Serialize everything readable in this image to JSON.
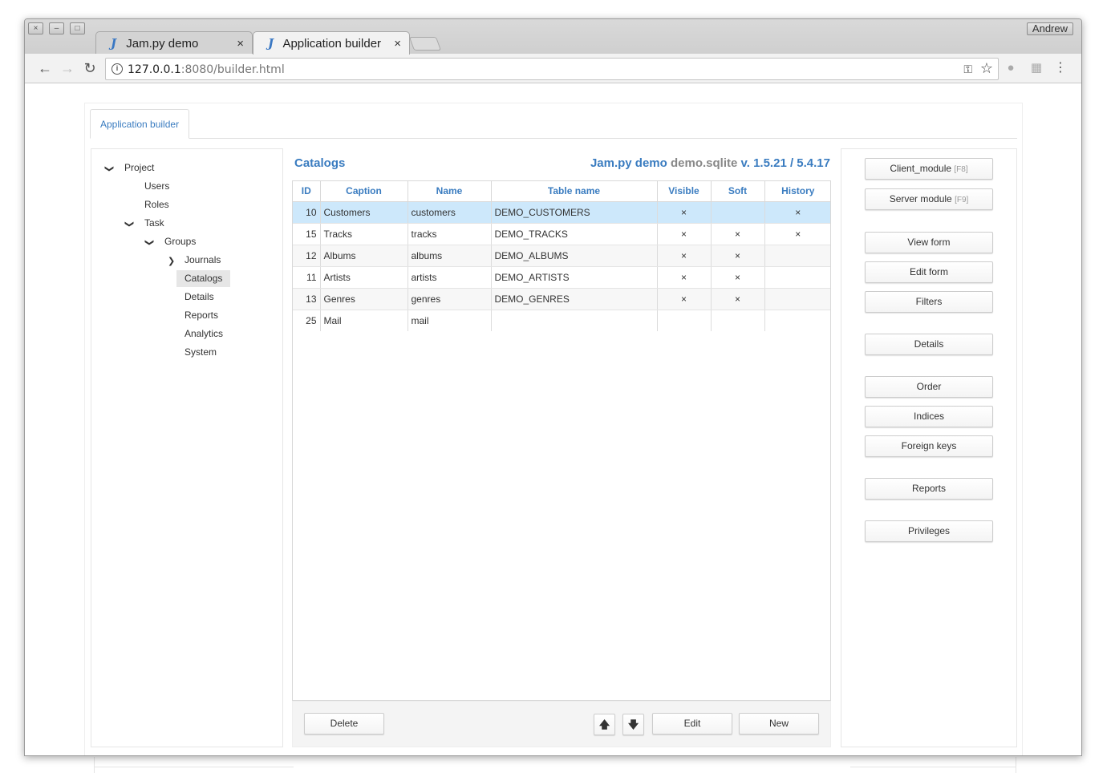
{
  "window": {
    "user": "Andrew",
    "controls": [
      "×",
      "–",
      "□"
    ]
  },
  "browser": {
    "tabs": [
      {
        "icon": "J",
        "label": "Jam.py demo",
        "close": "×"
      },
      {
        "icon": "J",
        "label": "Application builder",
        "close": "×"
      }
    ],
    "url_host": "127.0.0.1",
    "url_path": ":8080/builder.html"
  },
  "app": {
    "tab_label": "Application builder"
  },
  "tree": {
    "items": [
      {
        "label": "Project"
      },
      {
        "label": "Users"
      },
      {
        "label": "Roles"
      },
      {
        "label": "Task"
      },
      {
        "label": "Groups"
      },
      {
        "label": "Journals"
      },
      {
        "label": "Catalogs"
      },
      {
        "label": "Details"
      },
      {
        "label": "Reports"
      },
      {
        "label": "Analytics"
      },
      {
        "label": "System"
      }
    ]
  },
  "main": {
    "title": "Catalogs",
    "app_name": "Jam.py demo",
    "db_name": "demo.sqlite",
    "version": "v. 1.5.21 / 5.4.17"
  },
  "grid": {
    "columns": [
      "ID",
      "Caption",
      "Name",
      "Table name",
      "Visible",
      "Soft",
      "History"
    ],
    "rows": [
      {
        "id": "10",
        "caption": "Customers",
        "name": "customers",
        "table": "DEMO_CUSTOMERS",
        "visible": "×",
        "soft": "",
        "history": "×"
      },
      {
        "id": "15",
        "caption": "Tracks",
        "name": "tracks",
        "table": "DEMO_TRACKS",
        "visible": "×",
        "soft": "×",
        "history": "×"
      },
      {
        "id": "12",
        "caption": "Albums",
        "name": "albums",
        "table": "DEMO_ALBUMS",
        "visible": "×",
        "soft": "×",
        "history": ""
      },
      {
        "id": "11",
        "caption": "Artists",
        "name": "artists",
        "table": "DEMO_ARTISTS",
        "visible": "×",
        "soft": "×",
        "history": ""
      },
      {
        "id": "13",
        "caption": "Genres",
        "name": "genres",
        "table": "DEMO_GENRES",
        "visible": "×",
        "soft": "×",
        "history": ""
      },
      {
        "id": "25",
        "caption": "Mail",
        "name": "mail",
        "table": "",
        "visible": "",
        "soft": "",
        "history": ""
      }
    ]
  },
  "footer": {
    "delete": "Delete",
    "up": "🡅",
    "down": "🡇",
    "edit": "Edit",
    "new": "New"
  },
  "actions": {
    "client_module": "Client_module",
    "client_module_hint": "[F8]",
    "server_module": "Server module",
    "server_module_hint": "[F9]",
    "view_form": "View form",
    "edit_form": "Edit form",
    "filters": "Filters",
    "details": "Details",
    "order": "Order",
    "indices": "Indices",
    "foreign_keys": "Foreign keys",
    "reports": "Reports",
    "privileges": "Privileges"
  }
}
